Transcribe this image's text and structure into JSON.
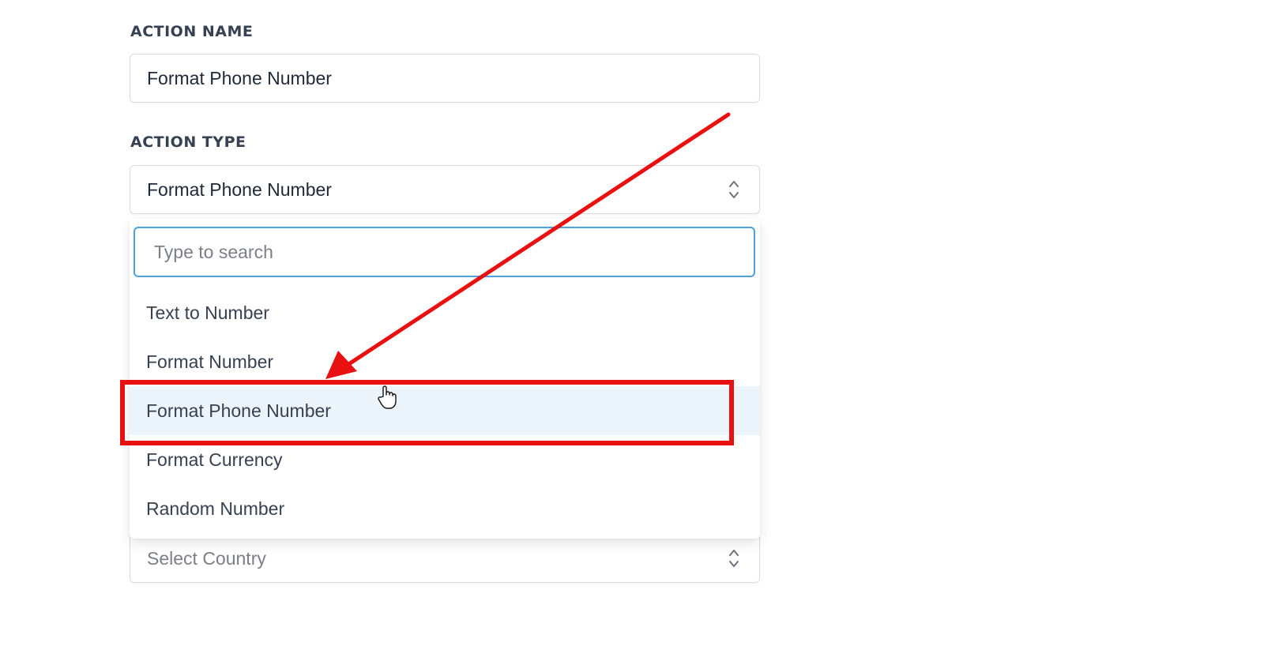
{
  "action_name": {
    "label": "ACTION NAME",
    "value": "Format Phone Number"
  },
  "action_type": {
    "label": "ACTION TYPE",
    "selected": "Format Phone Number",
    "icon": "chevron-up-down-icon"
  },
  "dropdown": {
    "search_placeholder": "Type to search",
    "options": [
      {
        "label": "Text to Number"
      },
      {
        "label": "Format Number"
      },
      {
        "label": "Format Phone Number",
        "highlighted": true
      },
      {
        "label": "Format Currency"
      },
      {
        "label": "Random Number"
      }
    ]
  },
  "country_select": {
    "placeholder": "Select Country",
    "icon": "chevron-up-down-icon"
  },
  "annotation": {
    "color": "#e81010",
    "highlight_color": "#eaf4fa",
    "focus_color": "#4da0dc"
  }
}
